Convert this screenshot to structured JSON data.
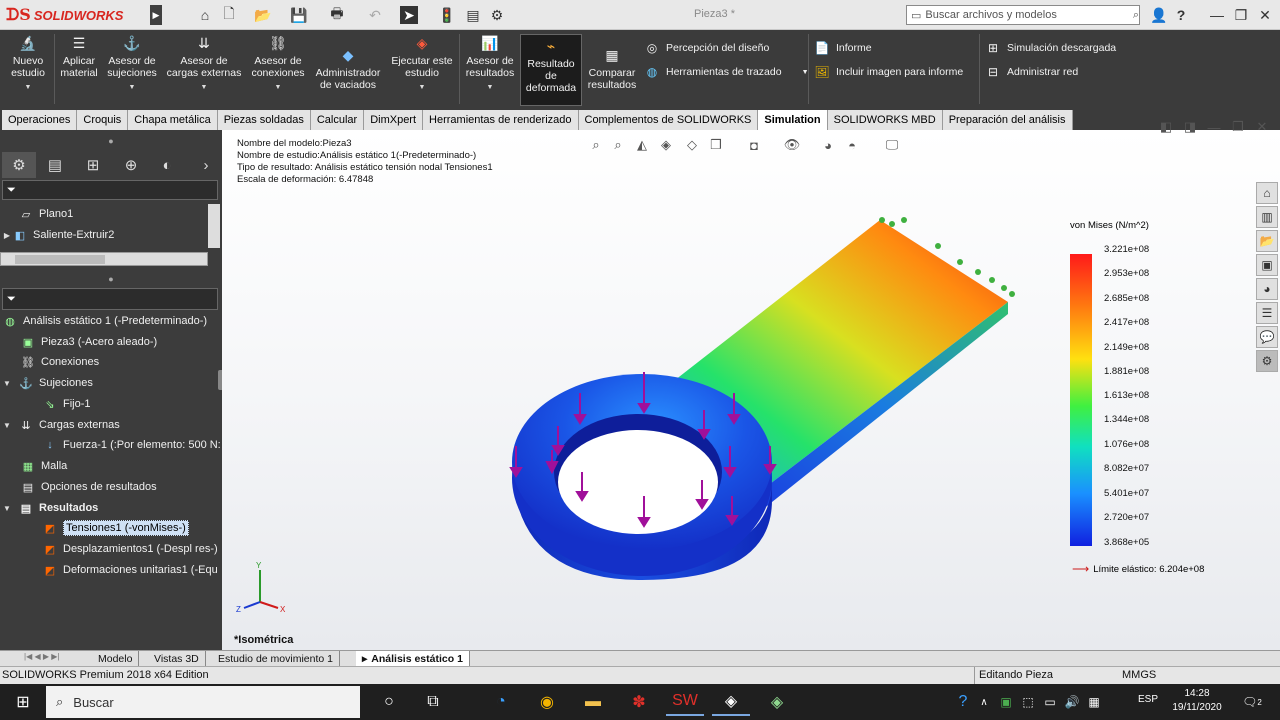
{
  "app": {
    "logo_text": "SOLIDWORKS",
    "doc_title": "Pieza3 *"
  },
  "search": {
    "placeholder": "Buscar archivos y modelos"
  },
  "toolbar_help": "?",
  "command_manager": {
    "buttons": [
      {
        "label": "Nuevo estudio",
        "icon": "study-icon"
      },
      {
        "label": "Aplicar material",
        "icon": "material-icon"
      },
      {
        "label": "Asesor de sujeciones",
        "icon": "fixture-icon"
      },
      {
        "label": "Asesor de cargas externas",
        "icon": "load-icon"
      },
      {
        "label": "Asesor de conexiones",
        "icon": "connection-icon"
      },
      {
        "label": "Administrador de vaciados",
        "icon": "shell-icon"
      },
      {
        "label": "Ejecutar este estudio",
        "icon": "run-icon"
      },
      {
        "label": "Asesor de resultados",
        "icon": "results-icon"
      },
      {
        "label": "Resultado de deformada",
        "icon": "deformed-icon"
      },
      {
        "label": "Comparar resultados",
        "icon": "compare-icon"
      }
    ],
    "rows": [
      {
        "label": "Percepción del diseño"
      },
      {
        "label": "Herramientas de trazado"
      },
      {
        "label": "Informe"
      },
      {
        "label": "Incluir imagen para informe"
      },
      {
        "label": "Simulación descargada"
      },
      {
        "label": "Administrar red"
      }
    ]
  },
  "tabs": [
    "Operaciones",
    "Croquis",
    "Chapa metálica",
    "Piezas soldadas",
    "Calcular",
    "DimXpert",
    "Herramientas de renderizado",
    "Complementos de SOLIDWORKS",
    "Simulation",
    "SOLIDWORKS MBD",
    "Preparación del análisis"
  ],
  "active_tab": "Simulation",
  "feature_tree": {
    "items": [
      "Plano1",
      "Saliente-Extruir2"
    ]
  },
  "study_tree": {
    "root": "Análisis estático 1 (-Predeterminado-)",
    "items": [
      {
        "label": "Pieza3 (-Acero aleado-)"
      },
      {
        "label": "Conexiones"
      },
      {
        "label": "Sujeciones"
      },
      {
        "label": "Fijo-1"
      },
      {
        "label": "Cargas externas"
      },
      {
        "label": "Fuerza-1 (:Por elemento: 500 N:"
      },
      {
        "label": "Malla"
      },
      {
        "label": "Opciones de resultados"
      },
      {
        "label": "Resultados"
      },
      {
        "label": "Tensiones1 (-vonMises-)"
      },
      {
        "label": "Desplazamientos1 (-Despl res-)"
      },
      {
        "label": "Deformaciones unitarias1 (-Equ"
      }
    ]
  },
  "viewport_info": {
    "model_name": "Nombre del modelo:Pieza3",
    "study_name": "Nombre de estudio:Análisis estático 1(-Predeterminado-)",
    "result_type": "Tipo de resultado: Análisis estático tensión nodal Tensiones1",
    "deformation_scale": "Escala de deformación: 6.47848"
  },
  "legend": {
    "title": "von Mises (N/m^2)",
    "values": [
      "3.221e+08",
      "2.953e+08",
      "2.685e+08",
      "2.417e+08",
      "2.149e+08",
      "1.881e+08",
      "1.613e+08",
      "1.344e+08",
      "1.076e+08",
      "8.082e+07",
      "5.401e+07",
      "2.720e+07",
      "3.868e+05"
    ],
    "elastic_limit": "Límite elástico: 6.204e+08",
    "elastic_color": "#cc1a1a"
  },
  "triad": {
    "x": "X",
    "y": "Y",
    "z": "Z"
  },
  "view_name": "*Isométrica",
  "bottom_tabs": [
    "Modelo",
    "Vistas 3D",
    "Estudio de movimiento 1",
    "Análisis estático 1"
  ],
  "status": {
    "edition": "SOLIDWORKS Premium 2018 x64 Edition",
    "mode": "Editando Pieza",
    "units": "MMGS"
  },
  "taskbar": {
    "search_placeholder": "Buscar",
    "lang": "ESP",
    "time": "14:28",
    "date": "19/11/2020",
    "notifications": "2"
  }
}
